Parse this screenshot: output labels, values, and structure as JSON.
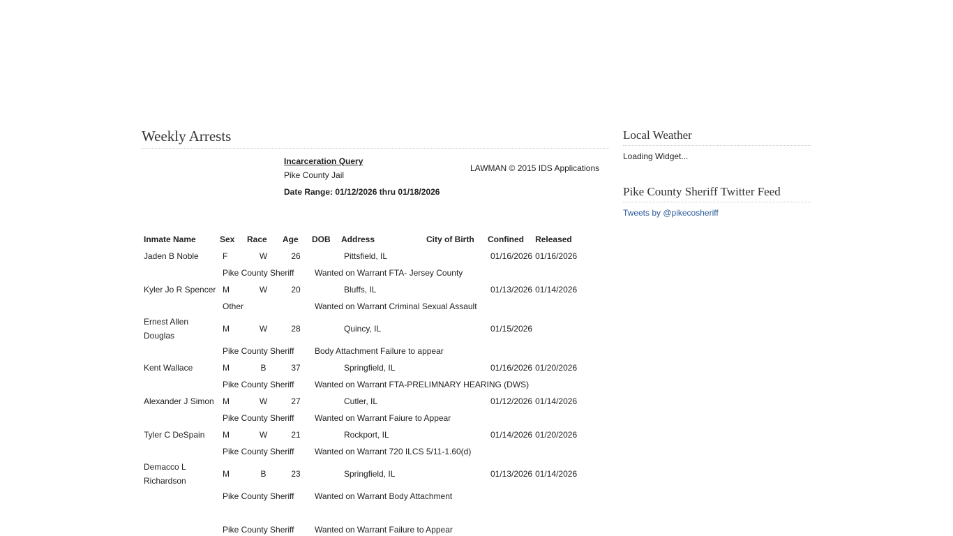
{
  "main": {
    "title": "Weekly Arrests",
    "report": {
      "query_link": "Incarceration Query",
      "jail": "Pike County Jail",
      "date_range_label": "Date Range: 01/12/2026 thru 01/18/2026",
      "lawman": "LAWMAN © 2015 IDS Applications"
    },
    "table": {
      "headers": {
        "name": "Inmate Name",
        "sex": "Sex",
        "race": "Race",
        "age": "Age",
        "dob": "DOB",
        "address": "Address",
        "city": "City of Birth",
        "confined": "Confined",
        "released": "Released"
      },
      "records": [
        {
          "name": "Jaden B Noble",
          "sex": "F",
          "race": "W",
          "age": "26",
          "address": "Pittsfield, IL",
          "confined": "01/16/2026",
          "released": "01/16/2026",
          "agency": "Pike County Sheriff",
          "charge": "Wanted on Warrant FTA- Jersey County"
        },
        {
          "name": "Kyler Jo R Spencer",
          "sex": "M",
          "race": "W",
          "age": "20",
          "address": "Bluffs, IL",
          "confined": "01/13/2026",
          "released": "01/14/2026",
          "agency": "Other",
          "charge": "Wanted on Warrant Criminal Sexual Assault"
        },
        {
          "name": "Ernest Allen Douglas",
          "sex": "M",
          "race": "W",
          "age": "28",
          "address": "Quincy, IL",
          "confined": "01/15/2026",
          "released": "",
          "agency": "Pike County Sheriff",
          "charge": "Body Attachment Failure to appear"
        },
        {
          "name": "Kent Wallace",
          "sex": "M",
          "race": "B",
          "age": "37",
          "address": "Springfield, IL",
          "confined": "01/16/2026",
          "released": "01/20/2026",
          "agency": "Pike County Sheriff",
          "charge": "Wanted on Warrant FTA-PRELIMNARY HEARING (DWS)"
        },
        {
          "name": "Alexander J Simon",
          "sex": "M",
          "race": "W",
          "age": "27",
          "address": "Cutler, IL",
          "confined": "01/12/2026",
          "released": "01/14/2026",
          "agency": "Pike County Sheriff",
          "charge": "Wanted on Warrant Faiure to Appear"
        },
        {
          "name": "Tyler C DeSpain",
          "sex": "M",
          "race": "W",
          "age": "21",
          "address": "Rockport, IL",
          "confined": "01/14/2026",
          "released": "01/20/2026",
          "agency": "Pike County Sheriff",
          "charge": "Wanted on Warrant 720 ILCS 5/11-1.60(d)"
        },
        {
          "name": "Demacco L Richardson",
          "sex": "M",
          "race": "B",
          "age": "23",
          "address": "Springfield, IL",
          "confined": "01/13/2026",
          "released": "01/14/2026",
          "agency": "Pike County Sheriff",
          "charge": "Wanted on Warrant Body Attachment"
        },
        {
          "name": "",
          "sex": "",
          "race": "",
          "age": "",
          "address": "",
          "confined": "",
          "released": "",
          "agency": "Pike County Sheriff",
          "charge": "Wanted on Warrant Failure to Appear"
        }
      ]
    }
  },
  "sidebar": {
    "weather_title": "Local Weather",
    "weather_status": "Loading Widget...",
    "twitter_title": "Pike County Sheriff Twitter Feed",
    "twitter_link": "Tweets by @pikecosheriff"
  }
}
